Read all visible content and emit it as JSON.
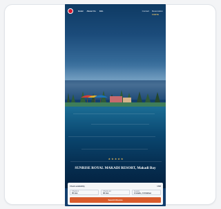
{
  "header": {
    "nav": [
      {
        "label": "Hotel"
      },
      {
        "label": "About Us"
      },
      {
        "label": "Info"
      }
    ],
    "actions": [
      {
        "label": "Contact"
      },
      {
        "label": "Reservation"
      }
    ],
    "brand": "FORTE"
  },
  "hero": {
    "rating": "★★★★★",
    "title": "SUNRISE ROYAL MAKADI RESORT, Makadi Bay"
  },
  "booking": {
    "heading": "Check availability",
    "currency": "USD",
    "fields": [
      {
        "label": "Check-in",
        "value": "05 Jan"
      },
      {
        "label": "Check-out",
        "value": "06 Jan"
      },
      {
        "label": "Guests",
        "value": "2 Adults, 0 Children"
      }
    ],
    "button_label": "Search Rooms"
  },
  "colors": {
    "accent": "#d95b2b",
    "brand": "#d5172f",
    "gold": "#d8b15a"
  }
}
